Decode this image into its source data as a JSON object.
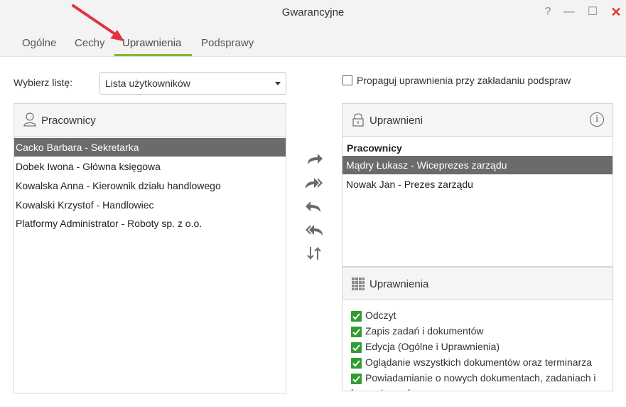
{
  "window": {
    "title": "Gwarancyjne",
    "help": "?",
    "minimize": "—",
    "maximize": "☐",
    "close": "✕"
  },
  "tabs": [
    {
      "label": "Ogólne"
    },
    {
      "label": "Cechy"
    },
    {
      "label": "Uprawnienia",
      "active": true
    },
    {
      "label": "Podsprawy"
    }
  ],
  "list_select": {
    "label": "Wybierz listę:",
    "value": "Lista użytkowników"
  },
  "propagate": {
    "label": "Propaguj uprawnienia przy zakładaniu podspraw",
    "checked": false
  },
  "employees_panel": {
    "title": "Pracownicy",
    "icon": "user-icon",
    "items": [
      {
        "label": "Cacko Barbara - Sekretarka",
        "selected": true
      },
      {
        "label": "Dobek Iwona - Główna księgowa"
      },
      {
        "label": "Kowalska Anna - Kierownik działu handlowego"
      },
      {
        "label": "Kowalski Krzystof - Handlowiec"
      },
      {
        "label": "Platformy Administrator - Roboty sp. z o.o."
      }
    ]
  },
  "authorized_panel": {
    "title": "Uprawnieni",
    "icon": "lock-icon",
    "group_label": "Pracownicy",
    "items": [
      {
        "label": "Mądry Łukasz - Wiceprezes zarządu",
        "selected": true
      },
      {
        "label": "Nowak Jan - Prezes zarządu"
      }
    ]
  },
  "permissions_panel": {
    "title": "Uprawnienia",
    "icon": "grid-icon",
    "items": [
      {
        "label": "Odczyt",
        "checked": true
      },
      {
        "label": "Zapis zadań i dokumentów",
        "checked": true
      },
      {
        "label": "Edycja (Ogólne i Uprawnienia)",
        "checked": true
      },
      {
        "label": "Oglądanie wszystkich dokumentów oraz terminarza",
        "checked": true
      },
      {
        "label": "Powiadamianie o nowych dokumentach, zadaniach i",
        "checked": true
      }
    ],
    "overflow_text": "komentarzach"
  },
  "colors": {
    "accent": "#7dbb2f",
    "check": "#2f9e2f",
    "selected_row": "#6b6b6b",
    "annotation_arrow": "#e0343c",
    "close": "#d9342b"
  }
}
